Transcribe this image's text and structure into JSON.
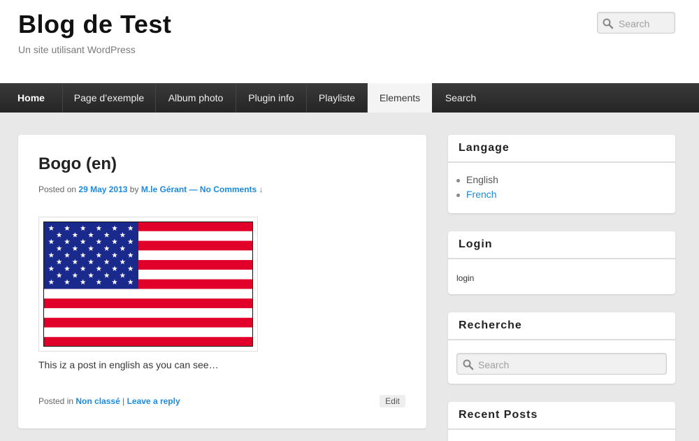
{
  "header": {
    "site_title": "Blog de Test",
    "site_description": "Un site utilisant WordPress",
    "search_placeholder": "Search"
  },
  "nav": {
    "items": [
      {
        "label": "Home"
      },
      {
        "label": "Page d’exemple"
      },
      {
        "label": "Album photo"
      },
      {
        "label": "Plugin info"
      },
      {
        "label": "Playliste"
      },
      {
        "label": "Elements"
      },
      {
        "label": "Search"
      }
    ],
    "active": "Elements"
  },
  "post": {
    "title": "Bogo (en)",
    "posted_on_label": "Posted on",
    "date": "29 May 2013",
    "by_label": "by",
    "author": "M.le Gérant",
    "comments_link": "— No Comments ↓",
    "image": "us-flag",
    "body": "This iz a post in english as you can see…",
    "posted_in_label": "Posted in",
    "category": "Non classé",
    "separator": "|",
    "reply_link": "Leave a reply",
    "edit_label": "Edit"
  },
  "sidebar": {
    "language": {
      "title": "Langage",
      "items": [
        {
          "label": "English",
          "current": true
        },
        {
          "label": "French",
          "current": false
        }
      ]
    },
    "login": {
      "title": "Login",
      "link": "login"
    },
    "search": {
      "title": "Recherche",
      "placeholder": "Search"
    },
    "recent_posts": {
      "title": "Recent Posts"
    }
  },
  "colors": {
    "link": "#1b8be0",
    "nav_bg": "#2f2f2f",
    "flag_red": "#e0002a",
    "flag_blue": "#1a2a8c"
  }
}
